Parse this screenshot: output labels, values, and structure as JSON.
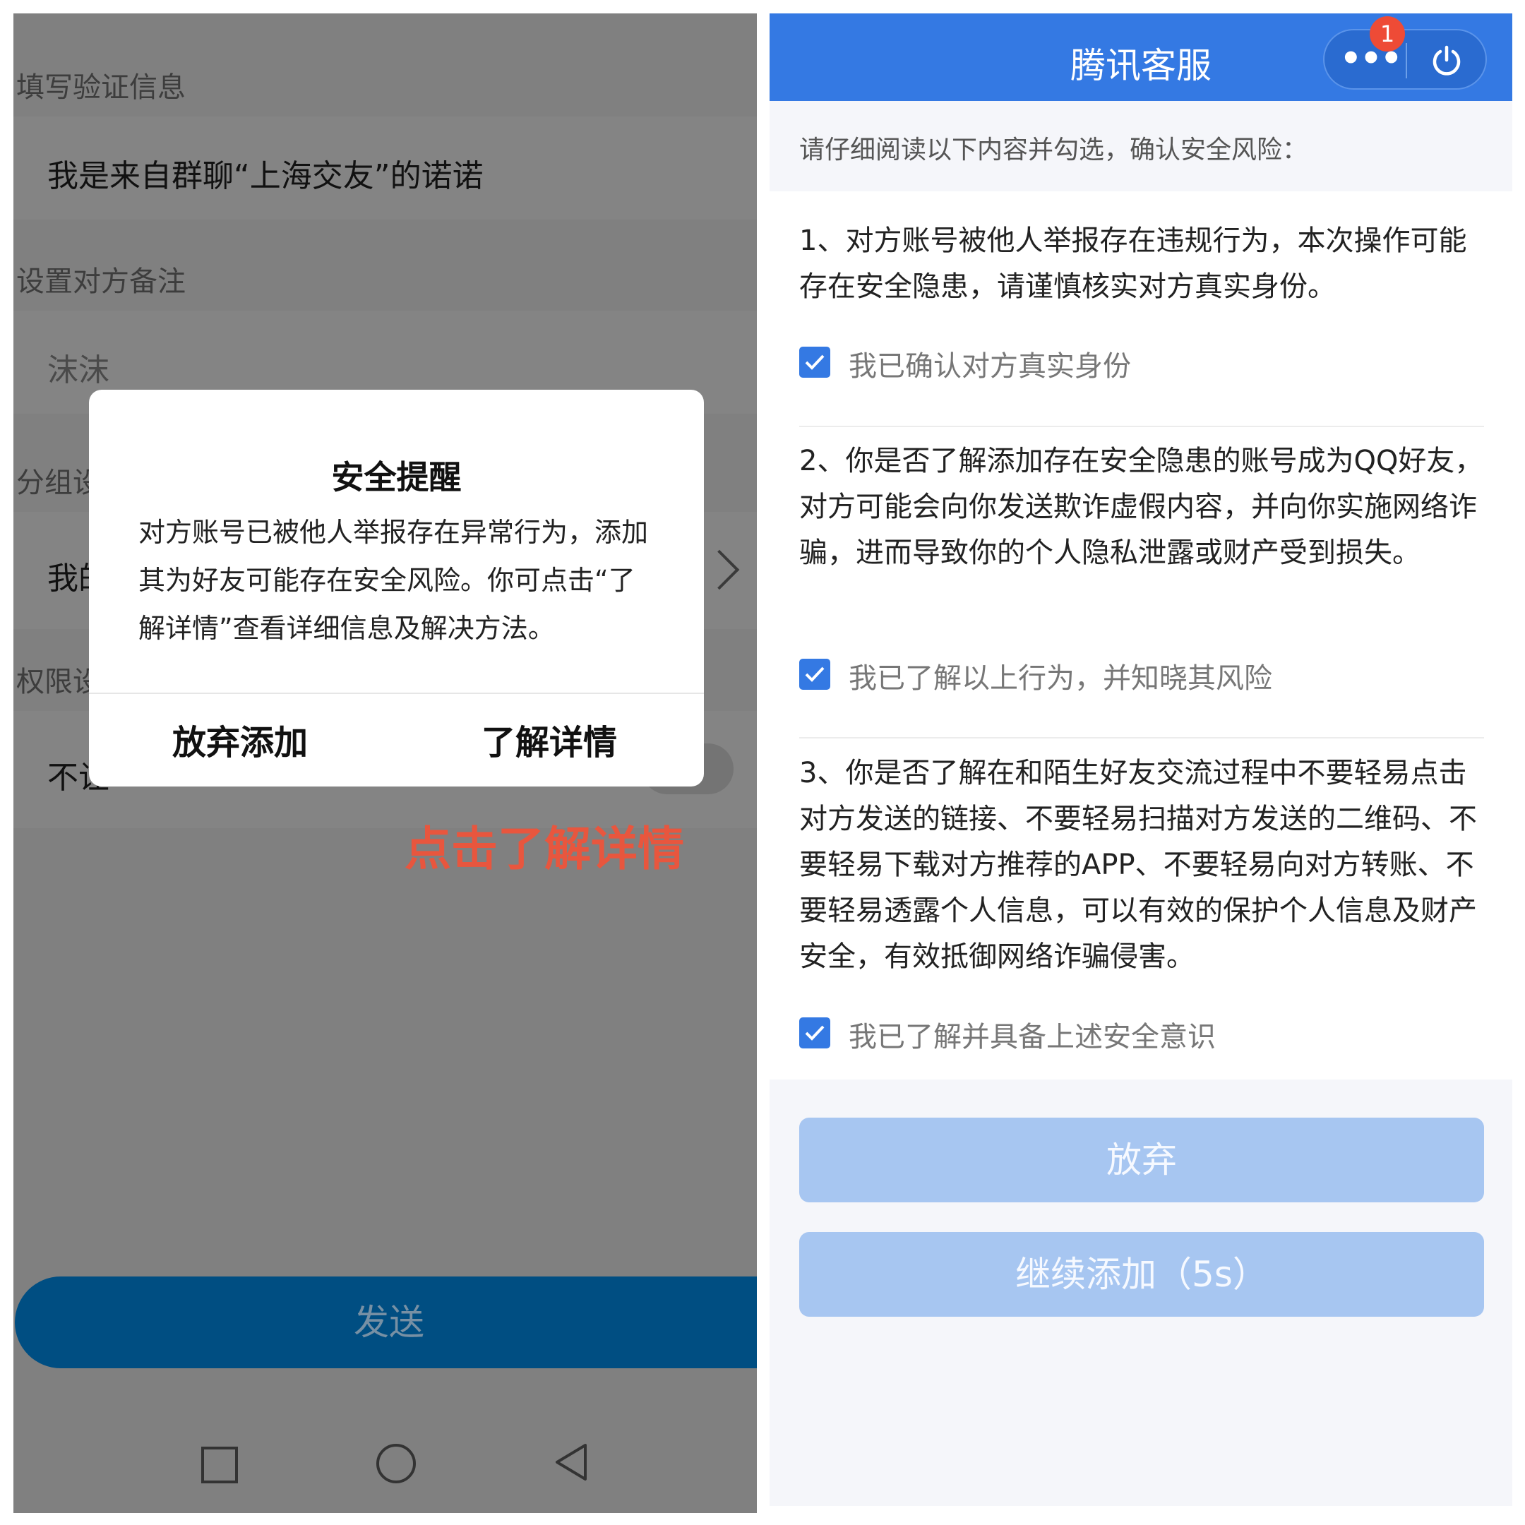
{
  "left": {
    "verify_label": "填写验证信息",
    "verify_message": "我是来自群聊“上海交友”的诺诺",
    "remark_label": "设置对方备注",
    "remark_value": "沫沫",
    "group_label": "分组设",
    "group_value": "我的",
    "permission_label": "权限设",
    "permission_value": "不让",
    "dialog": {
      "title": "安全提醒",
      "body": "对方账号已被他人举报存在异常行为，添加其为好友可能存在安全风险。你可点击“了解详情”查看详细信息及解决方法。",
      "cancel_label": "放弃添加",
      "details_label": "了解详情"
    },
    "annotation": "点击了解详情",
    "send_label": "发送",
    "nav": {
      "recent_icon": "square-icon",
      "home_icon": "circle-icon",
      "back_icon": "triangle-back-icon"
    }
  },
  "right": {
    "title": "腾讯客服",
    "badge_count": "1",
    "intro": "请仔细阅读以下内容并勾选，确认安全风险：",
    "items": [
      {
        "text": "1、对方账号被他人举报存在违规行为，本次操作可能存在安全隐患，请谨慎核实对方真实身份。",
        "check_label": "我已确认对方真实身份",
        "checked": true
      },
      {
        "text": "2、你是否了解添加存在安全隐患的账号成为QQ好友，对方可能会向你发送欺诈虚假内容，并向你实施网络诈骗，进而导致你的个人隐私泄露或财产受到损失。",
        "check_label": "我已了解以上行为，并知晓其风险",
        "checked": true
      },
      {
        "text": "3、你是否了解在和陌生好友交流过程中不要轻易点击对方发送的链接、不要轻易扫描对方发送的二维码、不要轻易下载对方推荐的APP、不要轻易向对方转账、不要轻易透露个人信息，可以有效的保护个人信息及财产安全，有效抵御网络诈骗侵害。",
        "check_label": "我已了解并具备上述安全意识",
        "checked": true
      }
    ],
    "abandon_label": "放弃",
    "continue_label": "继续添加（5s）"
  },
  "colors": {
    "header_blue": "#3479e3",
    "button_disabled": "#a7c6f1",
    "send_button": "#004e82",
    "annotation_red": "#e8563e",
    "overlay_gray": "#808080"
  }
}
